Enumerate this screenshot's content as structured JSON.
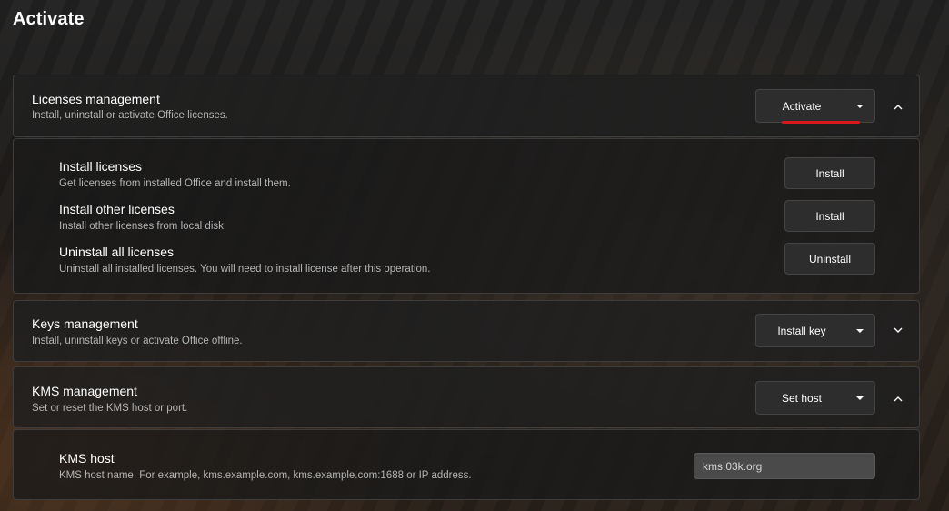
{
  "page": {
    "title": "Activate"
  },
  "licenses": {
    "title": "Licenses management",
    "description": "Install, uninstall or activate Office licenses.",
    "action_button": "Activate",
    "expanded": true,
    "items": [
      {
        "title": "Install licenses",
        "description": "Get licenses from installed Office and install them.",
        "button": "Install"
      },
      {
        "title": "Install other licenses",
        "description": "Install other licenses from local disk.",
        "button": "Install"
      },
      {
        "title": "Uninstall all licenses",
        "description": "Uninstall all installed licenses. You will need to install license after this operation.",
        "button": "Uninstall"
      }
    ]
  },
  "keys": {
    "title": "Keys management",
    "description": "Install, uninstall keys or activate Office offline.",
    "action_button": "Install key",
    "expanded": false
  },
  "kms": {
    "title": "KMS management",
    "description": "Set or reset the KMS host or port.",
    "action_button": "Set host",
    "expanded": true,
    "host": {
      "title": "KMS host",
      "description": "KMS host name. For example, kms.example.com, kms.example.com:1688 or IP address.",
      "value": "kms.03k.org"
    }
  },
  "colors": {
    "accent": "#d9181d",
    "card_border": "#3d3d3d",
    "button_bg": "#2d2d2d",
    "input_bg": "#4a4a4a"
  },
  "icons": {
    "dropdown": "caret-down-icon",
    "collapse": "chevron-up-icon",
    "expand": "chevron-down-icon"
  }
}
